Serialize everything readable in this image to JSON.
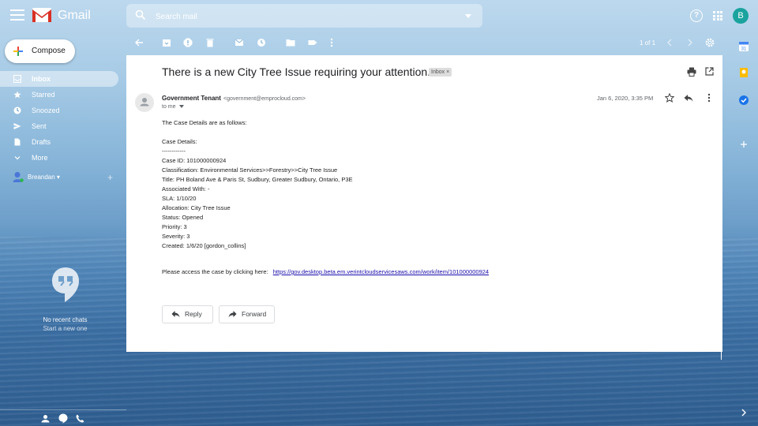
{
  "app": {
    "name": "Gmail",
    "search_placeholder": "Search mail",
    "avatar_letter": "B",
    "colors": {
      "accent": "#1aa39e",
      "link": "#1a0dab"
    }
  },
  "compose_label": "Compose",
  "nav": [
    {
      "label": "Inbox",
      "icon": "inbox-icon",
      "active": true
    },
    {
      "label": "Starred",
      "icon": "star-icon"
    },
    {
      "label": "Snoozed",
      "icon": "clock-icon"
    },
    {
      "label": "Sent",
      "icon": "send-icon"
    },
    {
      "label": "Drafts",
      "icon": "draft-icon"
    },
    {
      "label": "More",
      "icon": "chevron-down-icon"
    }
  ],
  "chat_user": "Breandan",
  "chats": {
    "empty_text": "No recent chats",
    "start_link": "Start a new one"
  },
  "pager": "1 of 1",
  "email": {
    "subject": "There is a new City Tree Issue requiring your attention.",
    "label_chip": "Inbox ×",
    "sender_name": "Government Tenant",
    "sender_email": "<government@emprocloud.com>",
    "to": "to me",
    "date": "Jan 6, 2020, 3:35 PM",
    "body_lines": [
      "The Case Details are as follows:",
      "",
      "Case Details:",
      "------------",
      "Case ID: 101000000924",
      "Classification: Environmental Services>>Forestry>>City Tree Issue",
      "Title: PH Boland Ave & Paris St, Sudbury, Greater Sudbury, Ontario, P3E",
      "Associated With: -",
      "SLA: 1/10/20",
      "Allocation: City Tree Issue",
      "Status: Opened",
      "Priority: 3",
      "Severity: 3",
      "Created: 1/6/20 [gordon_collins]"
    ],
    "access_text": "Please access the case by clicking here:",
    "access_link": "https://gov.desktop.beta.em.verintcloudservicesaws.com/work/item/101000000924",
    "reply_label": "Reply",
    "forward_label": "Forward"
  }
}
